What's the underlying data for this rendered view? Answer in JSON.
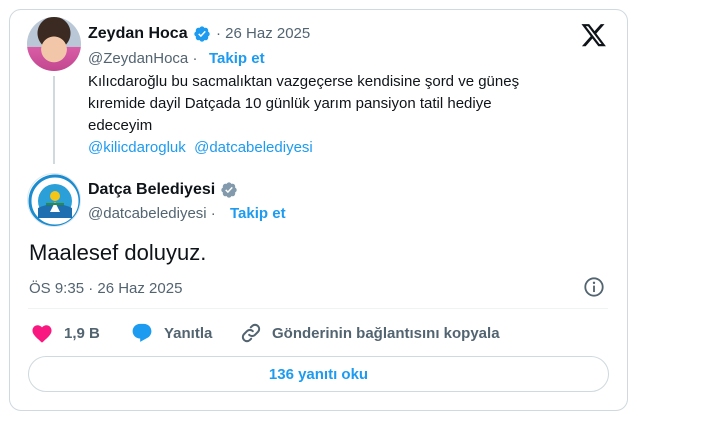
{
  "quoted": {
    "author_name": "Zeydan Hoca",
    "date": "· 26 Haz 2025",
    "handle": "@ZeydanHoca ·",
    "follow_label": "Takip et",
    "text_line1": "Kılıcdaroğlu bu sacmalıktan  vazgeçerse  kendisine şord ve güneş",
    "text_line2": "kıremide dayil Datçada  10 günlük yarım pansiyon tatil hediye",
    "text_line3": "edeceyim",
    "mention1": "@kilicdarogluk",
    "mention2": "@datcabelediyesi"
  },
  "reply": {
    "author_name": "Datça Belediyesi",
    "handle": "@datcabelediyesi ·",
    "follow_label": "Takip et",
    "text": "Maalesef doluyuz.",
    "timestamp": "ÖS 9:35 · 26 Haz 2025",
    "avatar_logo_text": "DATÇA BELEDİYESİ"
  },
  "actions": {
    "likes": "1,9 B",
    "reply_label": "Yanıtla",
    "copy_label": "Gönderinin bağlantısını kopyala",
    "read_replies": "136 yanıtı oku"
  },
  "colors": {
    "accent": "#1d9bf0",
    "like": "#f91880",
    "muted": "#536471",
    "verified_blue": "#1d9bf0",
    "verified_gray": "#829aab"
  },
  "icons": [
    "verified-badge-icon",
    "x-logo-icon",
    "info-icon",
    "heart-icon",
    "reply-bubble-icon",
    "link-icon"
  ]
}
